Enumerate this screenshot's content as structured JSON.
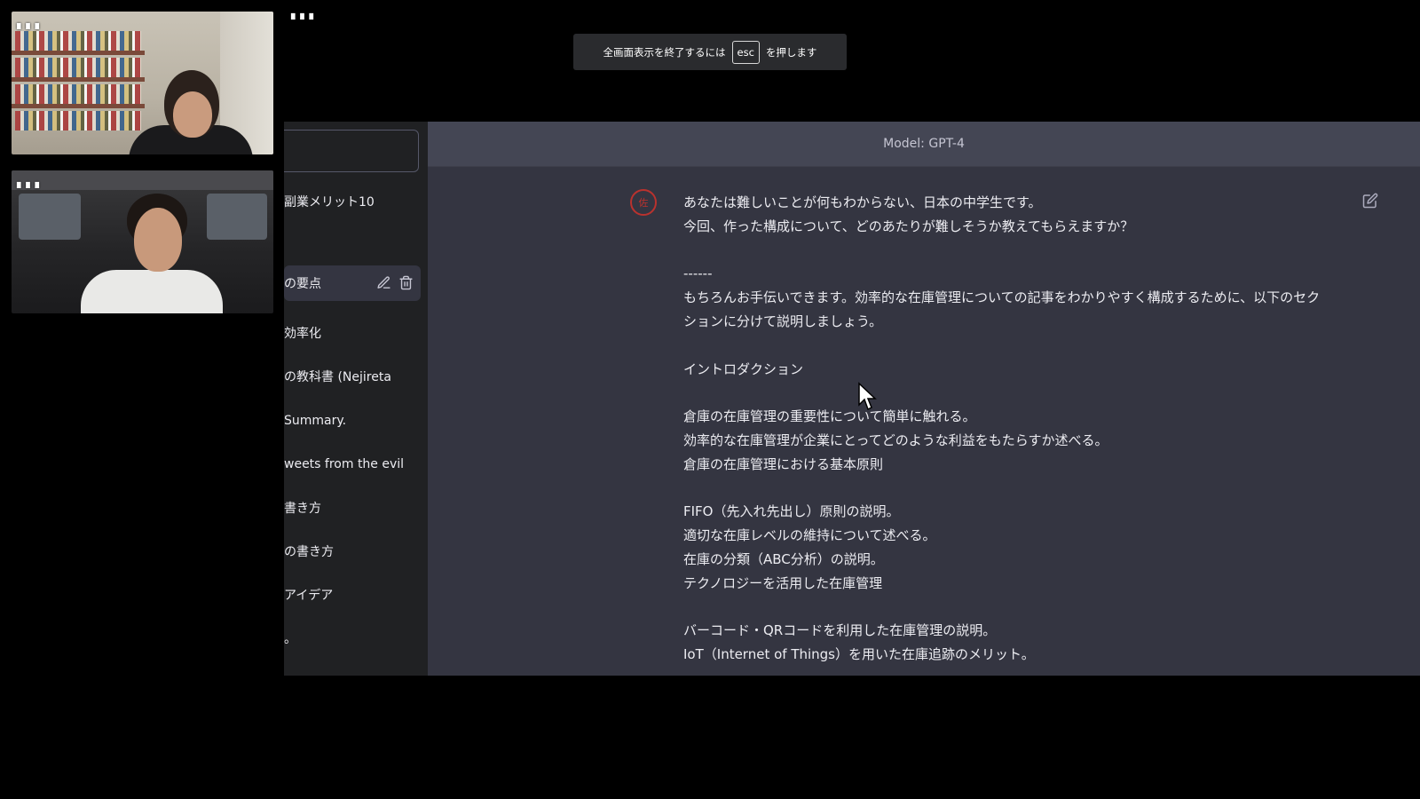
{
  "participants": [
    {
      "name": "▖▖▖"
    },
    {
      "name": "▖▖▖"
    },
    {
      "name": "▖▖▖"
    }
  ],
  "fullscreen_notice": {
    "before": "全画面表示を終了するには",
    "key": "esc",
    "after": "を押します"
  },
  "chat_app": {
    "model_label": "Model: GPT-4",
    "sidebar": {
      "items": [
        {
          "label": "副業メリット10"
        },
        {
          "label": "の要点"
        },
        {
          "label": "効率化"
        },
        {
          "label": "の教科書 (Nejireta"
        },
        {
          "label": "Summary."
        },
        {
          "label": "weets from the evil"
        },
        {
          "label": "書き方"
        },
        {
          "label": "の書き方"
        },
        {
          "label": "アイデア"
        },
        {
          "label": "。"
        }
      ]
    },
    "message": {
      "avatar_glyph": "佐",
      "lines": [
        "あなたは難しいことが何もわからない、日本の中学生です。",
        "今回、作った構成について、どのあたりが難しそうか教えてもらえますか？",
        "",
        "------",
        "もちろんお手伝いできます。効率的な在庫管理についての記事をわかりやすく構成するために、以下のセク",
        "ションに分けて説明しましょう。",
        "",
        "イントロダクション",
        "",
        "倉庫の在庫管理の重要性について簡単に触れる。",
        "効率的な在庫管理が企業にとってどのような利益をもたらすか述べる。",
        "倉庫の在庫管理における基本原則",
        "",
        "FIFO（先入れ先出し）原則の説明。",
        "適切な在庫レベルの維持について述べる。",
        "在庫の分類（ABC分析）の説明。",
        "テクノロジーを活用した在庫管理",
        "",
        "バーコード・QRコードを利用した在庫管理の説明。",
        "IoT（Internet of Things）を用いた在庫追跡のメリット。"
      ]
    }
  },
  "colors": {
    "sidebar_bg": "#202123",
    "main_bg": "#343541",
    "header_bg": "#444654",
    "avatar_red": "#b9322e"
  }
}
